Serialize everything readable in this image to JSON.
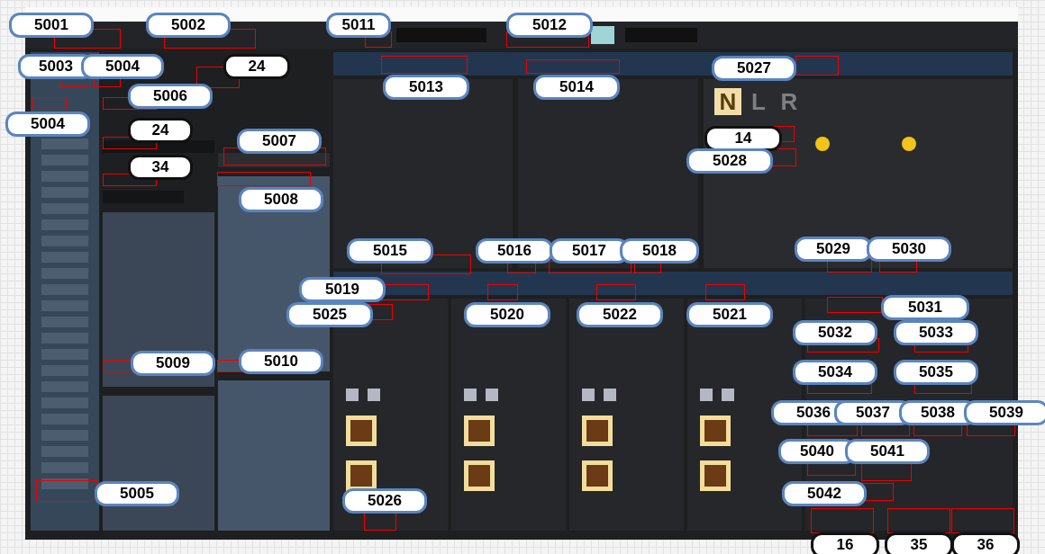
{
  "mode_letters": [
    {
      "label": "N",
      "selected": true
    },
    {
      "label": "L",
      "selected": false
    },
    {
      "label": "R",
      "selected": false
    }
  ],
  "callouts": [
    {
      "label": "5001",
      "kind": "blue"
    },
    {
      "label": "5002",
      "kind": "blue"
    },
    {
      "label": "5011",
      "kind": "blue"
    },
    {
      "label": "5012",
      "kind": "blue"
    },
    {
      "label": "5003",
      "kind": "blue"
    },
    {
      "label": "5004",
      "kind": "blue"
    },
    {
      "label": "24",
      "kind": "black"
    },
    {
      "label": "5027",
      "kind": "blue"
    },
    {
      "label": "5013",
      "kind": "blue"
    },
    {
      "label": "5014",
      "kind": "blue"
    },
    {
      "label": "5006",
      "kind": "blue"
    },
    {
      "label": "5004",
      "kind": "blue"
    },
    {
      "label": "24",
      "kind": "black"
    },
    {
      "label": "14",
      "kind": "black"
    },
    {
      "label": "5007",
      "kind": "blue"
    },
    {
      "label": "5028",
      "kind": "blue"
    },
    {
      "label": "34",
      "kind": "black"
    },
    {
      "label": "5008",
      "kind": "blue"
    },
    {
      "label": "5015",
      "kind": "blue"
    },
    {
      "label": "5016",
      "kind": "blue"
    },
    {
      "label": "5017",
      "kind": "blue"
    },
    {
      "label": "5018",
      "kind": "blue"
    },
    {
      "label": "5029",
      "kind": "blue"
    },
    {
      "label": "5030",
      "kind": "blue"
    },
    {
      "label": "5019",
      "kind": "blue"
    },
    {
      "label": "5031",
      "kind": "blue"
    },
    {
      "label": "5025",
      "kind": "blue"
    },
    {
      "label": "5020",
      "kind": "blue"
    },
    {
      "label": "5022",
      "kind": "blue"
    },
    {
      "label": "5021",
      "kind": "blue"
    },
    {
      "label": "5032",
      "kind": "blue"
    },
    {
      "label": "5033",
      "kind": "blue"
    },
    {
      "label": "5009",
      "kind": "blue"
    },
    {
      "label": "5010",
      "kind": "blue"
    },
    {
      "label": "5034",
      "kind": "blue"
    },
    {
      "label": "5035",
      "kind": "blue"
    },
    {
      "label": "5036",
      "kind": "blue"
    },
    {
      "label": "5037",
      "kind": "blue"
    },
    {
      "label": "5038",
      "kind": "blue"
    },
    {
      "label": "5039",
      "kind": "blue"
    },
    {
      "label": "5040",
      "kind": "blue"
    },
    {
      "label": "5041",
      "kind": "blue"
    },
    {
      "label": "5005",
      "kind": "blue"
    },
    {
      "label": "5042",
      "kind": "blue"
    },
    {
      "label": "5026",
      "kind": "blue"
    },
    {
      "label": "16",
      "kind": "black"
    },
    {
      "label": "35",
      "kind": "black"
    },
    {
      "label": "36",
      "kind": "black"
    }
  ]
}
